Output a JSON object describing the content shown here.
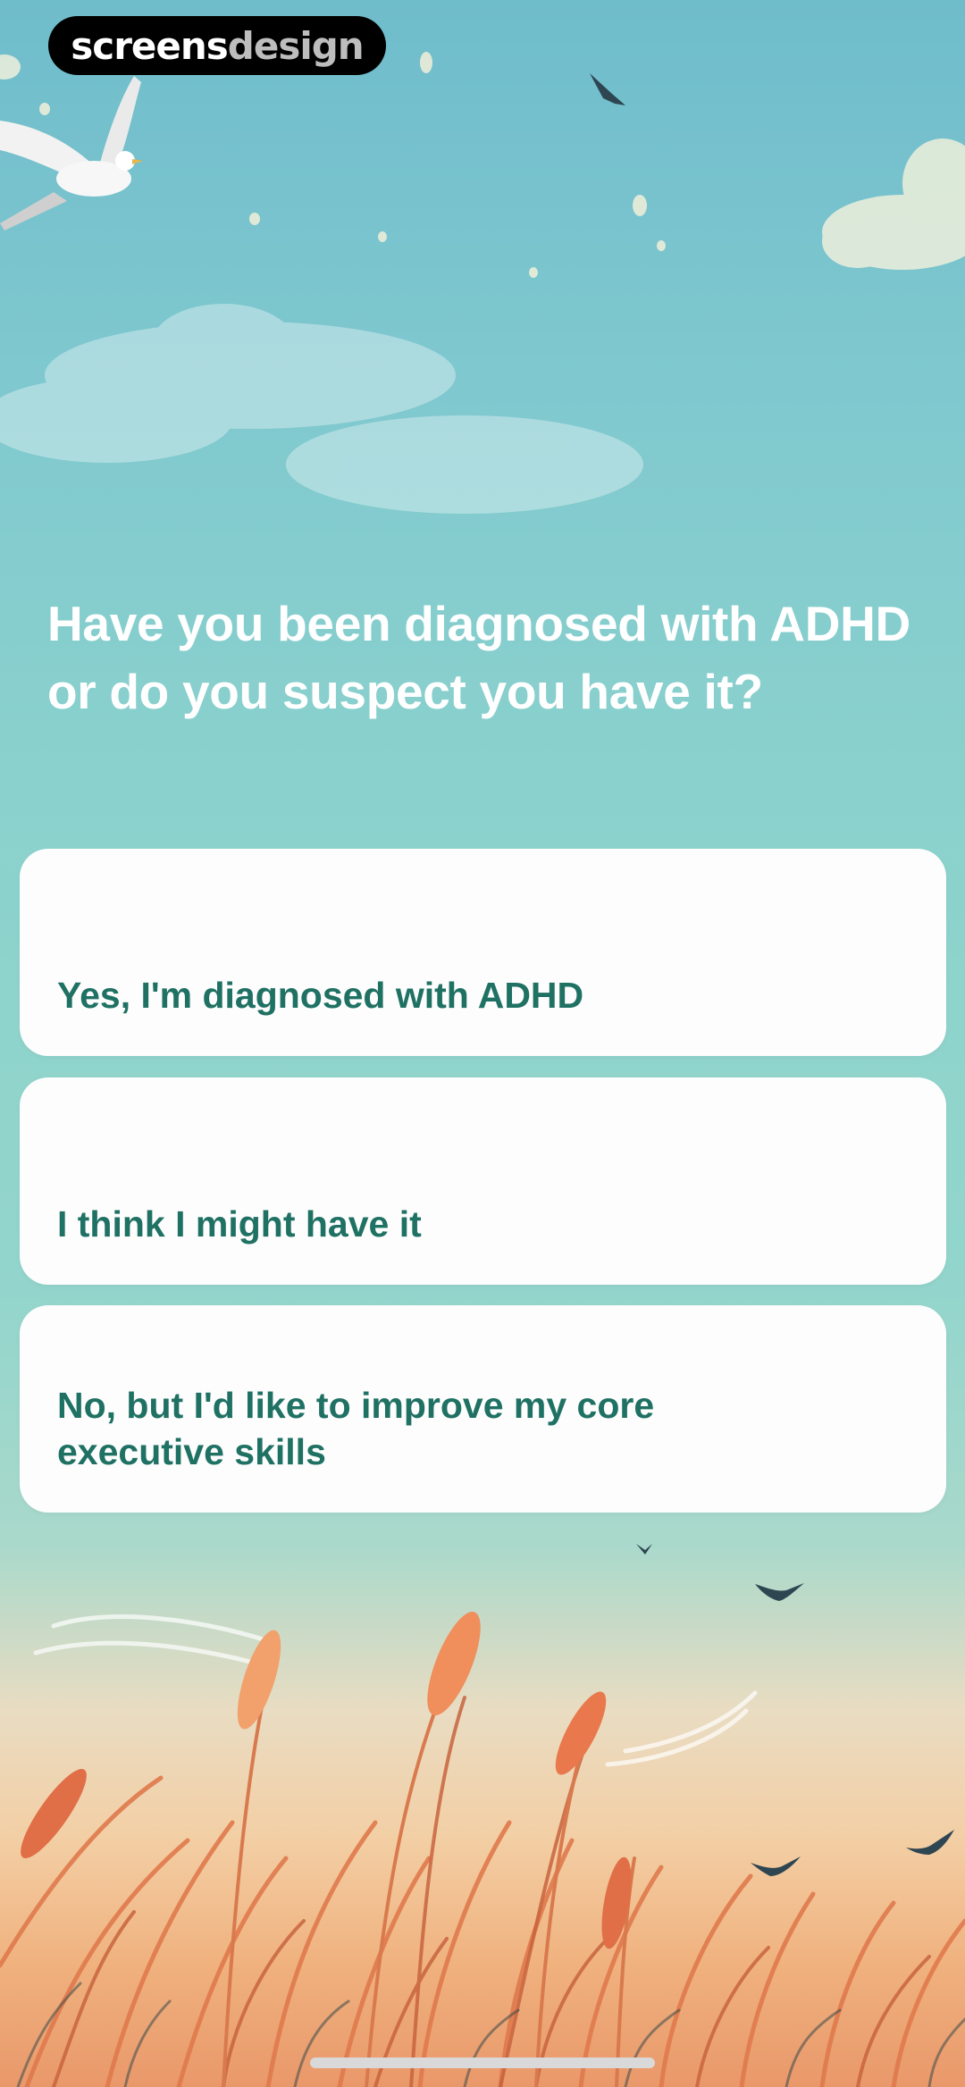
{
  "watermark": {
    "part1": "screens",
    "part2": "design"
  },
  "question": {
    "title": "Have you been diagnosed with ADHD or do you suspect you have it?"
  },
  "options": [
    {
      "label": "Yes, I'm diagnosed with ADHD"
    },
    {
      "label": "I think I might have it"
    },
    {
      "label": "No, but I'd like to improve my core executive skills"
    }
  ],
  "colors": {
    "option_text": "#1f7163",
    "option_bg": "#fdfdfd",
    "title_text": "#ffffff"
  }
}
